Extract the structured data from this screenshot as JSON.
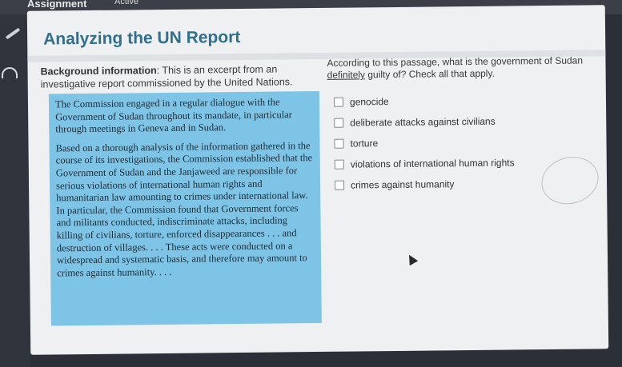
{
  "window": {
    "tab_assignment": "Assignment",
    "tab_status": "Active"
  },
  "page": {
    "title": "Analyzing the UN Report",
    "background_label": "Background information",
    "background_text": ": This is an excerpt from an investigative report commissioned by the United Nations."
  },
  "excerpt": {
    "paragraph1": "The Commission engaged in a regular dialogue with the Government of Sudan throughout its mandate, in particular through meetings in Geneva and in Sudan.",
    "paragraph2": "Based on a thorough analysis of the information gathered in the course of its investigations, the Commission established that the Government of Sudan and the Janjaweed are responsible for serious violations of international human rights and humanitarian law amounting to crimes under international law. In particular, the Commission found that Government forces and militants conducted, indiscriminate attacks, including killing of civilians, torture, enforced disappearances . . . and destruction of villages. . . . These acts were conducted on a widespread and systematic basis, and therefore may amount to crimes against humanity. . . ."
  },
  "question": {
    "text_before": "According to this passage, what is the government of Sudan ",
    "emphasis": "definitely",
    "text_after": " guilty of? Check all that apply."
  },
  "options": [
    {
      "label": "genocide"
    },
    {
      "label": "deliberate attacks against civilians"
    },
    {
      "label": "torture"
    },
    {
      "label": "violations of international human rights"
    },
    {
      "label": "crimes against humanity"
    }
  ],
  "icons": {
    "rail_top": "pencil-icon",
    "rail_second": "arc-icon",
    "cursor": "mouse-pointer-icon"
  }
}
